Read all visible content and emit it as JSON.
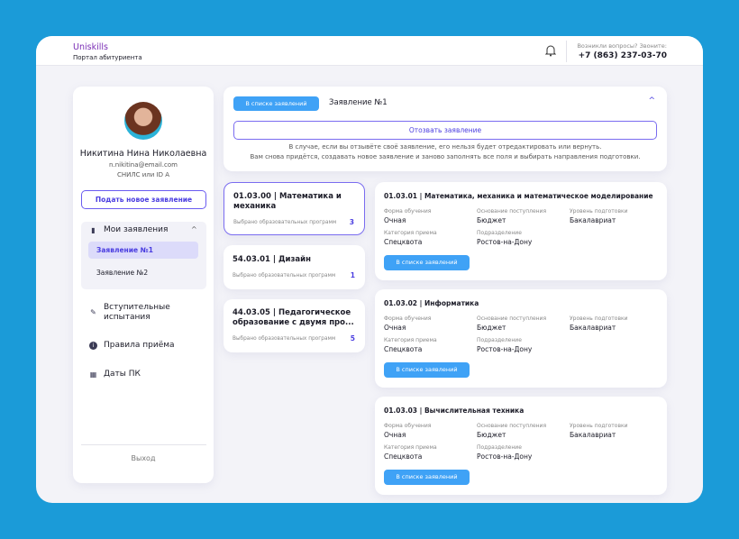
{
  "header": {
    "brand": "Uniskills",
    "subtitle": "Портал абитуриента",
    "question": "Возникли вопросы? Звоните:",
    "phone": "+7 (863) 237-03-70"
  },
  "profile": {
    "name": "Никитина Нина Николаевна",
    "email": "n.nikitina@email.com",
    "snils": "СНИЛС или ID A",
    "new_application": "Подать новое заявление"
  },
  "nav": {
    "my_applications": "Мои заявления",
    "applications": [
      "Заявление №1",
      "Заявление №2"
    ],
    "items": [
      "Вступительные испытания",
      "Правила приёма",
      "Даты ПК"
    ],
    "exit": "Выход"
  },
  "application": {
    "status": "В списке заявлений",
    "title": "Заявление №1",
    "revoke": "Отозвать заявление",
    "note1": "В случае, если вы отзывёте своё заявление, его нельзя будет отредактировать или вернуть.",
    "note2": "Вам снова придётся, создавать новое заявление и заново заполнять все поля и выбирать направления подготовки."
  },
  "programs": [
    {
      "title": "01.03.00 | Математика и механика",
      "label": "Выбрано образовательных программ",
      "count": "3"
    },
    {
      "title": "54.03.01 | Дизайн",
      "label": "Выбрано образовательных программ",
      "count": "1"
    },
    {
      "title": "44.03.05 | Педагогическое образование с двумя про...",
      "label": "Выбрано образовательных программ",
      "count": "5"
    }
  ],
  "labels": {
    "form": "Форма обучения",
    "basis": "Основание поступления",
    "level": "Уровень подготовки",
    "category": "Категория приема",
    "division": "Подразделение"
  },
  "details": [
    {
      "title": "01.03.01 | Математика, механика и математическое моделирование",
      "form": "Очная",
      "basis": "Бюджет",
      "level": "Бакалавриат",
      "category": "Спецквота",
      "division": "Ростов-на-Дону",
      "button": "В списке заявлений"
    },
    {
      "title": "01.03.02 | Информатика",
      "form": "Очная",
      "basis": "Бюджет",
      "level": "Бакалавриат",
      "category": "Спецквота",
      "division": "Ростов-на-Дону",
      "button": "В списке заявлений"
    },
    {
      "title": "01.03.03 | Вычислительная техника",
      "form": "Очная",
      "basis": "Бюджет",
      "level": "Бакалавриат",
      "category": "Спецквота",
      "division": "Ростов-на-Дону",
      "button": "В списке заявлений"
    }
  ]
}
